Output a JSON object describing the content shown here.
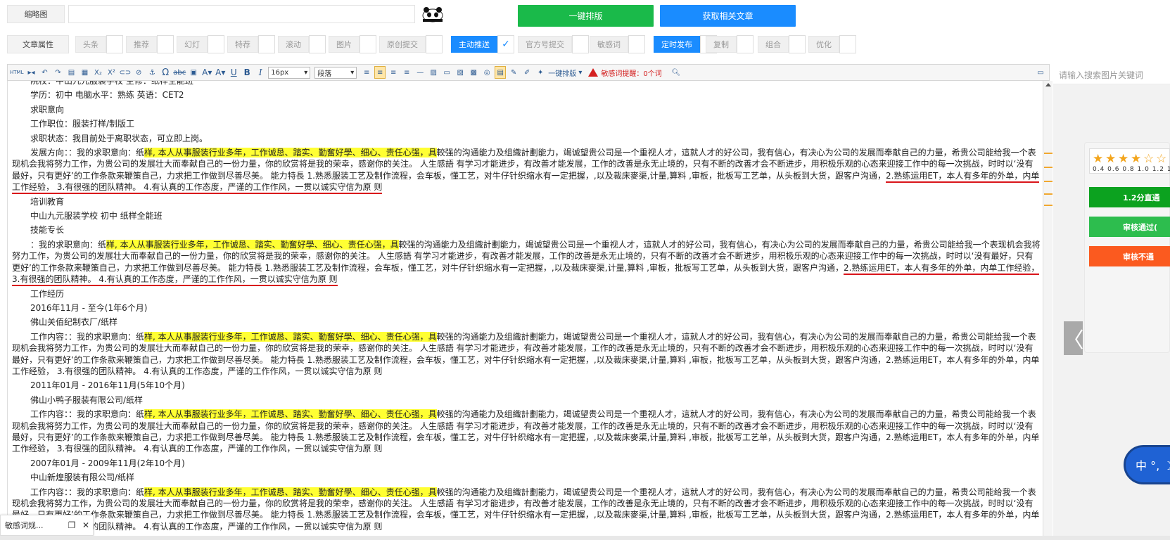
{
  "top": {
    "thumbnail_label": "缩略图",
    "one_click_layout": "一键排版",
    "get_related": "获取相关文章",
    "colors": {
      "green": "#1aba4a",
      "blue": "#1a8cff"
    }
  },
  "attributes": {
    "label": "文章属性",
    "items": [
      {
        "label": "头条",
        "on": false,
        "checked": false
      },
      {
        "label": "推荐",
        "on": false,
        "checked": false
      },
      {
        "label": "幻灯",
        "on": false,
        "checked": false
      },
      {
        "label": "特荐",
        "on": false,
        "checked": false
      },
      {
        "label": "滚动",
        "on": false,
        "checked": false
      },
      {
        "label": "图片",
        "on": false,
        "checked": false
      },
      {
        "label": "原创提交",
        "on": false,
        "checked": false
      },
      {
        "label": "主动推送",
        "on": true,
        "checked": true
      },
      {
        "label": "官方号提交",
        "on": false,
        "checked": false
      },
      {
        "label": "敏感词",
        "on": false,
        "checked": false
      },
      {
        "label": "定时发布",
        "on": true,
        "checked": true
      },
      {
        "label": "复制",
        "on": false,
        "checked": false
      },
      {
        "label": "组合",
        "on": false,
        "checked": false
      },
      {
        "label": "优化",
        "on": false,
        "checked": false
      }
    ]
  },
  "toolbar": {
    "html_label": "HTML",
    "font_size": "16px",
    "paragraph": "段落",
    "one_click_layout": "一键排版",
    "sensitive_warning": "敏感词提醒：0个词",
    "icons": [
      "undo-icon",
      "redo-icon",
      "copy-format-icon",
      "subscript-icon",
      "superscript-icon",
      "link-icon",
      "unlink-icon",
      "anchor-icon",
      "omega-icon",
      "strikethrough-icon",
      "text-a-icon",
      "font-color-icon",
      "underline-icon",
      "bold-icon",
      "italic-icon"
    ]
  },
  "editor": {
    "line_school": "院校：中山九元服装学校 主修：纸样全能班",
    "line_edu": "学历：初中 电脑水平：熟练 英语：CET2",
    "job_intent": "求职意向",
    "job_position": "工作职位：服装打样/制版工",
    "job_status": "求职状态：我目前处于离职状态，可立即上岗。",
    "dev_prefix": "发展方向：：我的求职意向：纸",
    "hl_text": "样, 本人从事服装行业多年，工作诚恳、踏实、勤奮好學、细心、责任心强，具",
    "body_rest": "較强的沟通能力及组織計劃能力，竭诚望贵公司是一个重视人才，這就人才的好公司，我有信心，有决心为公司的发展而奉献自己的力量，希贵公司能给我一个表现机会我将努力工作，为贵公司的发展壮大而奉献自己的一份力量，你的欣赏将是我的荣幸，感谢你的关注。 人生感語 有学习才能进步，有改善才能发展，工作的改善是永无止境的，只有不断的改善才会不断进步，用积极乐观的心态来迎接工作中的每一次挑战，时时以‘没有最好，只有更好’的工作条款来鞭策自己，力求把工作做到尽善尽美。 能力特長 1.熟悉服装工艺及制作流程，会车板，懂工艺，对牛仔针织缩水有一定把握，,以及裁床麥渠,计量,算料 ,审板，批板写工艺单，从头板到大货，跟客户沟通，",
    "body_tail": "2.熟练运用ET，本人有多年的外单，内单工作经验， 3.有很强的团队精神。 4.有认真的工作态度，严谨的工作作风，一贯以诚实守信为原 则",
    "training": "培训教育",
    "training_detail": "中山九元服装学校 初中 纸样全能班",
    "skills": "技能专长",
    "skill_prefix": "：我的求职意向：纸",
    "work_exp": "工作经历",
    "job1_date": "2016年11月 - 至今(1年6个月)",
    "job1_company": "佛山关佰纪制衣厂/纸样",
    "work_prefix": "工作内容：：我的求职意向：纸",
    "job2_date": "2011年01月 - 2016年11月(5年10个月)",
    "job2_company": "佛山小鸭子服装有限公司/纸样",
    "job3_date": "2007年01月 - 2009年11月(2年10个月)",
    "job3_company": "中山新煌服装有限公司/纸样"
  },
  "side": {
    "search_placeholder": "请输入搜索图片关键词",
    "rates": "0.4 0.6 0.8 1.0 1.2 1",
    "stars_filled": 4,
    "btn1": "1.2分直通",
    "btn2": "审核通过(",
    "btn3": "审核不通",
    "btn_colors": [
      "#0ca21f",
      "#2dbd4e",
      "#fb5a1f"
    ],
    "nav_arrow": "〈",
    "ime_text": "中 °, ☽"
  },
  "mini_popup": {
    "label": "敏感词规...",
    "restore": "❐",
    "close": "✕"
  }
}
